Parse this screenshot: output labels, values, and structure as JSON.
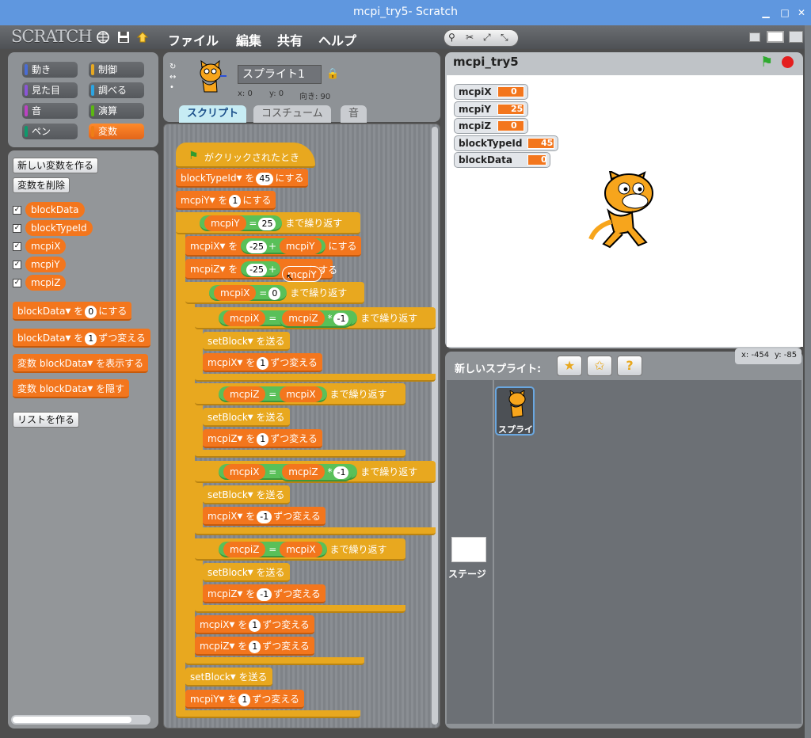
{
  "window": {
    "title": "mcpi_try5- Scratch"
  },
  "menu": {
    "logo": "SCRATCH",
    "file": "ファイル",
    "edit": "編集",
    "share": "共有",
    "help": "ヘルプ"
  },
  "categories": [
    {
      "label": "動き",
      "color": "#4a6cd4"
    },
    {
      "label": "制御",
      "color": "#e6a822"
    },
    {
      "label": "見た目",
      "color": "#8a55d7"
    },
    {
      "label": "調べる",
      "color": "#2ca5e2"
    },
    {
      "label": "音",
      "color": "#bb42c3"
    },
    {
      "label": "演算",
      "color": "#5cb712"
    },
    {
      "label": "ペン",
      "color": "#0e9a6c"
    },
    {
      "label": "変数",
      "color": "#ee7d16"
    }
  ],
  "palette": {
    "make_var": "新しい変数を作る",
    "delete_var": "変数を削除",
    "variables": [
      "blockData",
      "blockTypeId",
      "mcpiX",
      "mcpiY",
      "mcpiZ"
    ],
    "set_block": {
      "var": "blockData",
      "mid": "を",
      "val": "0",
      "tail": "にする"
    },
    "change_block": {
      "var": "blockData",
      "mid": "を",
      "val": "1",
      "tail": "ずつ変える"
    },
    "show_block": {
      "pre": "変数",
      "var": "blockData",
      "tail": "を表示する"
    },
    "hide_block": {
      "pre": "変数",
      "var": "blockData",
      "tail": "を隠す"
    },
    "make_list": "リストを作る"
  },
  "sprite": {
    "name": "スプライト1",
    "x_label": "x: 0",
    "y_label": "y: 0",
    "dir_label": "向き: 90"
  },
  "tabs": {
    "scripts": "スクリプト",
    "costumes": "コスチューム",
    "sounds": "音"
  },
  "script": {
    "hat": "がクリックされたとき",
    "set1": {
      "var": "blockTypeId",
      "mid": "を",
      "val": "45",
      "tail": "にする"
    },
    "set2": {
      "var": "mcpiY",
      "mid": "を",
      "val": "1",
      "tail": "にする"
    },
    "until1": {
      "left": "mcpiY",
      "op": "=",
      "right": "25",
      "tail": "まで繰り返す"
    },
    "setx": {
      "var": "mcpiX",
      "mid": "を",
      "num": "-25",
      "plus": "+",
      "rvar": "mcpiY",
      "tail": "にする"
    },
    "setz": {
      "var": "mcpiZ",
      "mid": "を",
      "num": "-25",
      "plus": "+",
      "tail": "にする"
    },
    "drag_ghost": "mcpiY",
    "until2": {
      "left": "mcpiX",
      "op": "=",
      "right": "0",
      "tail": "まで繰り返す"
    },
    "loops": [
      {
        "left": "mcpiX",
        "op": "=",
        "rvar": "mcpiZ",
        "mul": "*",
        "mval": "-1",
        "tail": "まで繰り返す",
        "send": "setBlock",
        "send_tail": "を送る",
        "cvar": "mcpiX",
        "cmid": "を",
        "cval": "1",
        "ctail": "ずつ変える"
      },
      {
        "left": "mcpiZ",
        "op": "=",
        "rvar": "mcpiX",
        "tail": "まで繰り返す",
        "send": "setBlock",
        "send_tail": "を送る",
        "cvar": "mcpiZ",
        "cmid": "を",
        "cval": "1",
        "ctail": "ずつ変える"
      },
      {
        "left": "mcpiX",
        "op": "=",
        "rvar": "mcpiZ",
        "mul": "*",
        "mval": "-1",
        "tail": "まで繰り返す",
        "send": "setBlock",
        "send_tail": "を送る",
        "cvar": "mcpiX",
        "cmid": "を",
        "cval": "-1",
        "ctail": "ずつ変える"
      },
      {
        "left": "mcpiZ",
        "op": "=",
        "rvar": "mcpiX",
        "tail": "まで繰り返す",
        "send": "setBlock",
        "send_tail": "を送る",
        "cvar": "mcpiZ",
        "cmid": "を",
        "cval": "-1",
        "ctail": "ずつ変える"
      }
    ],
    "after1": {
      "var": "mcpiX",
      "mid": "を",
      "val": "1",
      "tail": "ずつ変える"
    },
    "after2": {
      "var": "mcpiZ",
      "mid": "を",
      "val": "1",
      "tail": "ずつ変える"
    },
    "send_end": {
      "msg": "setBlock",
      "tail": "を送る"
    },
    "last": {
      "var": "mcpiY",
      "mid": "を",
      "val": "1",
      "tail": "ずつ変える"
    }
  },
  "stage": {
    "title": "mcpi_try5",
    "monitors": [
      {
        "name": "mcpiX",
        "value": "0"
      },
      {
        "name": "mcpiY",
        "value": "25"
      },
      {
        "name": "mcpiZ",
        "value": "0"
      },
      {
        "name": "blockTypeId",
        "value": "45"
      },
      {
        "name": "blockData",
        "value": "0"
      }
    ],
    "coords_x": "x: -454",
    "coords_y": "y: -85"
  },
  "sprites": {
    "new_sprite": "新しいスプライト:",
    "stage_label": "ステージ",
    "sprite_thumb": "スプライト1"
  }
}
